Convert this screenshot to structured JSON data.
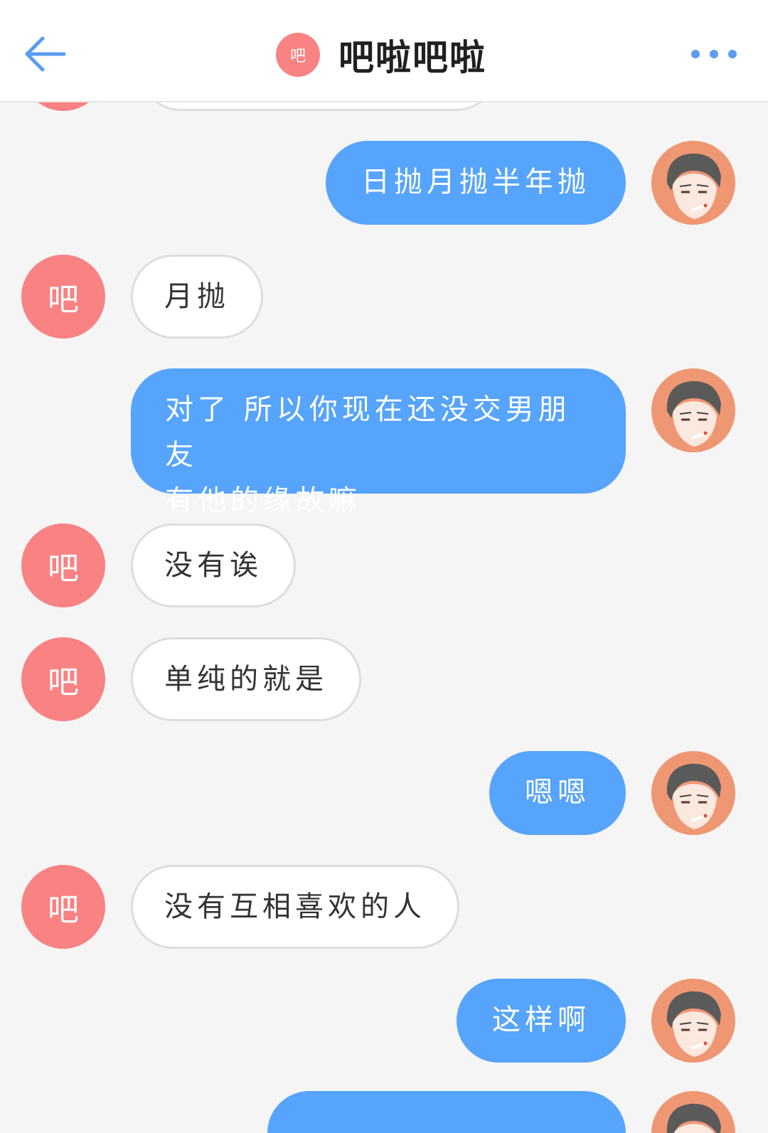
{
  "header": {
    "back_icon": "arrow-left-icon",
    "avatar_char": "吧",
    "title": "吧啦吧啦",
    "more_icon": "more-horizontal-icon",
    "accent_color": "#5b9cf0"
  },
  "colors": {
    "incoming_avatar": "#f98283",
    "outgoing_bubble": "#56a4fb",
    "incoming_bubble": "#ffffff",
    "background": "#f5f5f5"
  },
  "incoming_avatar_char": "吧",
  "messages": [
    {
      "from": "self",
      "text": "日抛月抛半年抛"
    },
    {
      "from": "other",
      "text": "月抛"
    },
    {
      "from": "self",
      "lines": [
        "对了 所以你现在还没交男朋友",
        "有他的缘故嘛"
      ]
    },
    {
      "from": "other",
      "text": "没有诶"
    },
    {
      "from": "other",
      "text": "单纯的就是"
    },
    {
      "from": "self",
      "text": "嗯嗯"
    },
    {
      "from": "other",
      "text": "没有互相喜欢的人"
    },
    {
      "from": "self",
      "text": "这样啊"
    }
  ]
}
